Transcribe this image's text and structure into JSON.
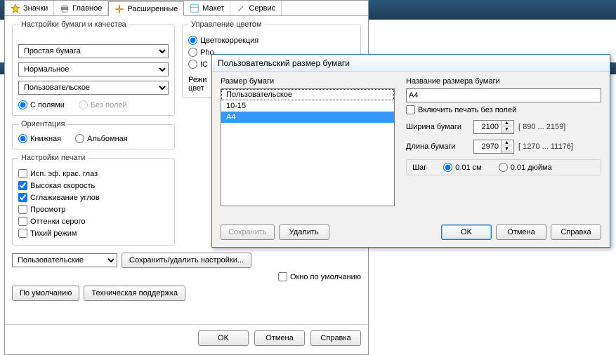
{
  "tabs": {
    "icons": "Значки",
    "main": "Главное",
    "advanced": "Расширенные",
    "layout": "Макет",
    "service": "Сервис"
  },
  "paper_quality": {
    "legend": "Настройки бумаги и качества",
    "paper_type": "Простая бумага",
    "quality": "Нормальное",
    "size": "Пользовательское",
    "with_margins": "С полями",
    "no_margins": "Без полей"
  },
  "orientation": {
    "legend": "Ориентация",
    "portrait": "Книжная",
    "landscape": "Альбомная"
  },
  "print_options": {
    "legend": "Настройки печати",
    "red_eye": "Исп. эф. крас. глаз",
    "high_speed": "Высокая скорость",
    "smooth": "Сглаживание углов",
    "preview": "Просмотр",
    "gray": "Оттенки серого",
    "quiet": "Тихий режим"
  },
  "color_mgmt": {
    "legend": "Управление цветом",
    "color_correction": "Цветокоррекция",
    "photo": "Pho",
    "icm": "IC",
    "modes_label_1": "Режи",
    "modes_label_2": "цвет"
  },
  "footer": {
    "preset_select": "Пользовательские",
    "save_delete_settings": "Сохранить/удалить настройки...",
    "default_window": "Окно по умолчанию",
    "defaults_btn": "По умолчанию",
    "tech_support": "Техническая поддержка"
  },
  "bottom": {
    "ok": "OK",
    "cancel": "Отмена",
    "help": "Справка"
  },
  "dialog": {
    "title": "Пользовательский размер бумаги",
    "left_label": "Размер бумаги",
    "items": [
      "Пользовательское",
      "10-15",
      "A4"
    ],
    "save": "Сохранить",
    "delete": "Удалить",
    "name_label": "Название размера бумаги",
    "name_value": "A4",
    "borderless": "Включить печать без полей",
    "width_label": "Ширина бумаги",
    "width_value": "2100",
    "width_range": "[ 890 ... 2159]",
    "length_label": "Длина бумаги",
    "length_value": "2970",
    "length_range": "[ 1270 ... 11176]",
    "step_label": "Шаг",
    "step_cm": "0.01 см",
    "step_in": "0.01 дюйма",
    "ok": "OK",
    "cancel": "Отмена",
    "help": "Справка"
  }
}
